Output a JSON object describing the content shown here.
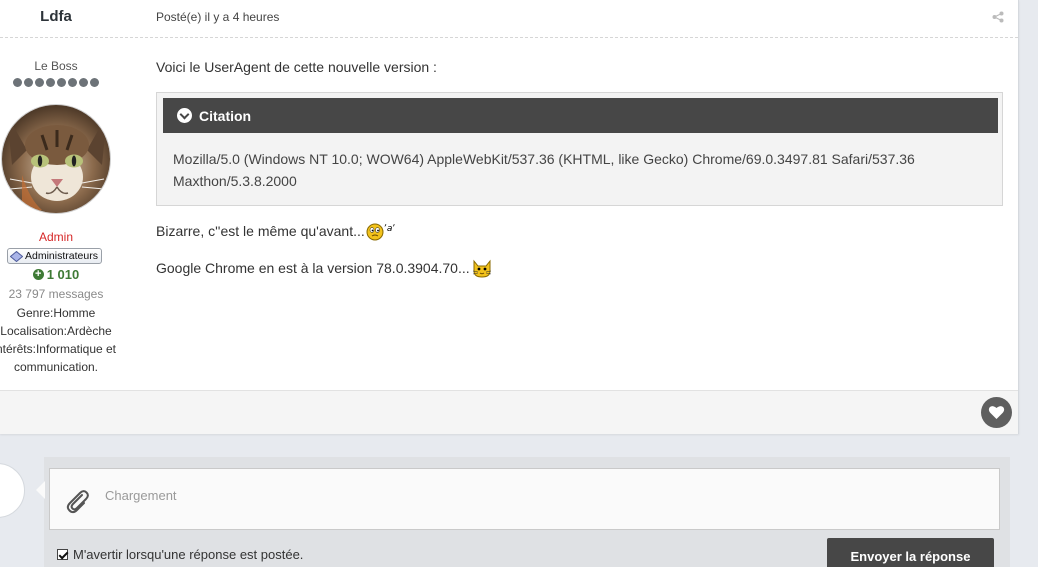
{
  "post": {
    "author": "Ldfa",
    "date": "Posté(e) il y a 4 heures",
    "rank_title": "Le Boss",
    "rank_pips": 8,
    "group": "Admin",
    "group_badge": "Administrateurs",
    "reputation": "1 010",
    "message_count": "23 797 messages",
    "fields": [
      "Genre:Homme",
      "Localisation:Ardèche",
      "ntérêts:Informatique et",
      "communication."
    ],
    "intro": "Voici le UserAgent de cette nouvelle version :",
    "quote": {
      "title": "Citation",
      "lines": [
        "Mozilla/5.0 (Windows NT 10.0; WOW64) AppleWebKit/537.36 (KHTML, like Gecko) Chrome/69.0.3497.81 Safari/537.36",
        "Maxthon/5.3.8.2000"
      ]
    },
    "line1": "Bizarre, c''est le même qu'avant...",
    "line2": "Google Chrome en est à la version 78.0.3904.70..."
  },
  "reply": {
    "placeholder": "Chargement",
    "notify_label": "M'avertir lorsqu'une réponse est postée.",
    "notify_checked": true,
    "submit_label": "Envoyer la réponse"
  },
  "icons": {
    "share": "share-icon",
    "like": "heart-icon",
    "attach": "paperclip-icon",
    "quote_toggle": "chevron-down-icon",
    "reputation": "plus-icon",
    "badge": "diamond-icon"
  },
  "colors": {
    "group": "#d62727",
    "reputation": "#3e7a35",
    "quote_header": "#474747",
    "button": "#474747"
  }
}
